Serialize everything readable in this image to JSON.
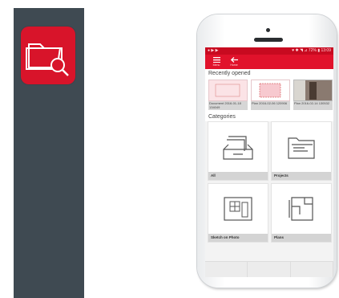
{
  "status": {
    "left": "● ▶ ▶",
    "right": "♥ ✱ ◥ ⊿ 72% ▮ 13:09"
  },
  "toolbar": {
    "menu_label": "Menu",
    "home_label": "Home"
  },
  "recent": {
    "title": "Recently opened",
    "items": [
      {
        "caption": "Document 2016-01-18 134049"
      },
      {
        "caption": "Plan 2016-02-06 120906"
      },
      {
        "caption": "Plan 2016-02-14 130532"
      }
    ]
  },
  "categories": {
    "title": "Categories",
    "items": [
      {
        "label": "All"
      },
      {
        "label": "Projects"
      },
      {
        "label": "Sketch on Photo"
      },
      {
        "label": "Plans"
      }
    ]
  },
  "colors": {
    "brand_red": "#e1122b",
    "side_panel": "#3f4a52"
  },
  "icons": {
    "app": "folder-search-icon"
  }
}
